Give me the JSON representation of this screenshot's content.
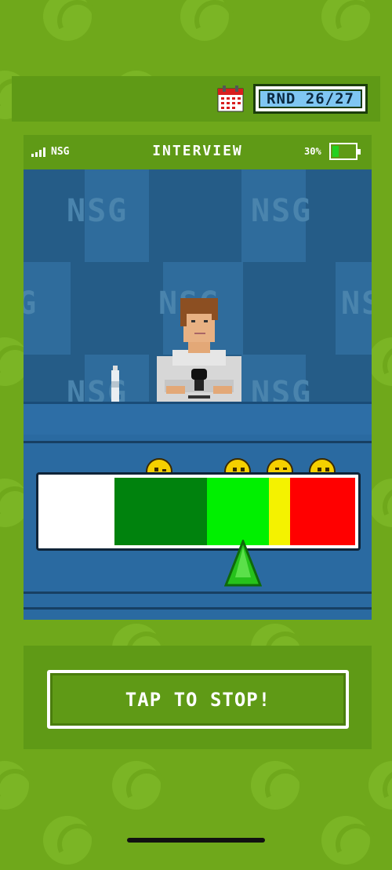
{
  "header": {
    "round_label": "RND 26/27",
    "calendar_icon": "calendar-icon"
  },
  "status_bar": {
    "carrier": "NSG",
    "title": "INTERVIEW",
    "battery_percent_text": "30%",
    "battery_level": 0.3
  },
  "scene": {
    "backdrop_logo": "NSG",
    "meter": {
      "segments": [
        {
          "name": "white",
          "color": "#ffffff"
        },
        {
          "name": "dark-green",
          "color": "#00820d"
        },
        {
          "name": "light-green",
          "color": "#00f000"
        },
        {
          "name": "yellow",
          "color": "#f4f200"
        },
        {
          "name": "red",
          "color": "#ff0000"
        }
      ],
      "pointer_color": "#26c21b",
      "emoji_faces": [
        "wink-face-icon",
        "smile-face-icon",
        "grin-face-icon",
        "grimace-face-icon"
      ]
    }
  },
  "action": {
    "button_label": "TAP TO STOP!"
  },
  "colors": {
    "background": "#6fa81b",
    "panel": "#5f9a16",
    "round_box": "#7fc6f2"
  }
}
